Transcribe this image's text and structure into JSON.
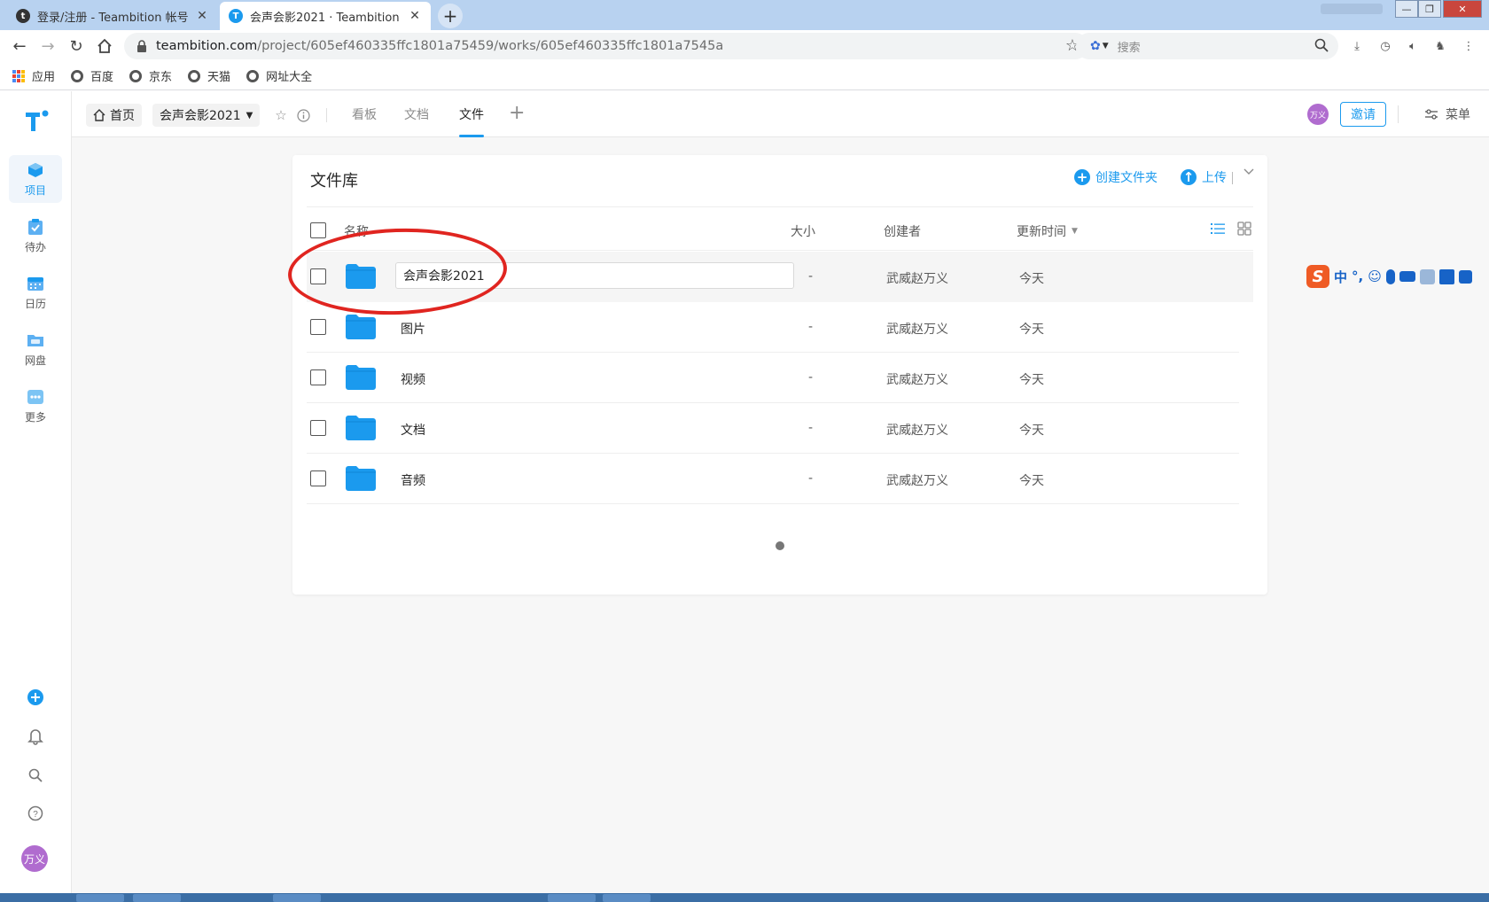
{
  "browser": {
    "tabs": [
      {
        "title": "登录/注册 - Teambition 帐号",
        "favicon": "t",
        "active": false
      },
      {
        "title": "会声会影2021 · Teambition",
        "favicon": "T",
        "active": true
      }
    ],
    "url_host": "teambition.com",
    "url_path": "/project/605ef460335ffc1801a75459/works/605ef460335ffc1801a7545a",
    "search_placeholder": "搜索",
    "bookmarks": [
      {
        "label": "应用",
        "icon": "apps-grid-icon"
      },
      {
        "label": "百度",
        "icon": "globe-icon"
      },
      {
        "label": "京东",
        "icon": "globe-icon"
      },
      {
        "label": "天猫",
        "icon": "globe-icon"
      },
      {
        "label": "网址大全",
        "icon": "globe-icon"
      }
    ]
  },
  "sidebar": {
    "items": [
      {
        "label": "项目",
        "icon": "project-cube-icon",
        "active": true
      },
      {
        "label": "待办",
        "icon": "todo-clipboard-icon",
        "active": false
      },
      {
        "label": "日历",
        "icon": "calendar-icon",
        "active": false
      },
      {
        "label": "网盘",
        "icon": "folder-drive-icon",
        "active": false
      },
      {
        "label": "更多",
        "icon": "more-dots-icon",
        "active": false
      }
    ],
    "avatar_text": "万义"
  },
  "header": {
    "home_label": "首页",
    "project_name": "会声会影2021",
    "tabs": [
      {
        "label": "看板",
        "active": false
      },
      {
        "label": "文档",
        "active": false
      },
      {
        "label": "文件",
        "active": true
      }
    ],
    "avatar_text": "万义",
    "invite_label": "邀请",
    "menu_label": "菜单"
  },
  "library": {
    "title": "文件库",
    "create_folder_label": "创建文件夹",
    "upload_label": "上传",
    "columns": {
      "name": "名称",
      "size": "大小",
      "creator": "创建者",
      "updated": "更新时间"
    },
    "rows": [
      {
        "name": "会声会影2021",
        "size": "-",
        "creator": "武威赵万义",
        "updated": "今天",
        "renaming": true
      },
      {
        "name": "图片",
        "size": "-",
        "creator": "武威赵万义",
        "updated": "今天",
        "renaming": false
      },
      {
        "name": "视频",
        "size": "-",
        "creator": "武威赵万义",
        "updated": "今天",
        "renaming": false
      },
      {
        "name": "文档",
        "size": "-",
        "creator": "武威赵万义",
        "updated": "今天",
        "renaming": false
      },
      {
        "name": "音频",
        "size": "-",
        "creator": "武威赵万义",
        "updated": "今天",
        "renaming": false
      }
    ]
  },
  "ime": {
    "mode": "中",
    "punct": "°,"
  },
  "colors": {
    "accent": "#1b9aee",
    "annotation": "#e02520",
    "tabbar": "#b8d2f0"
  }
}
